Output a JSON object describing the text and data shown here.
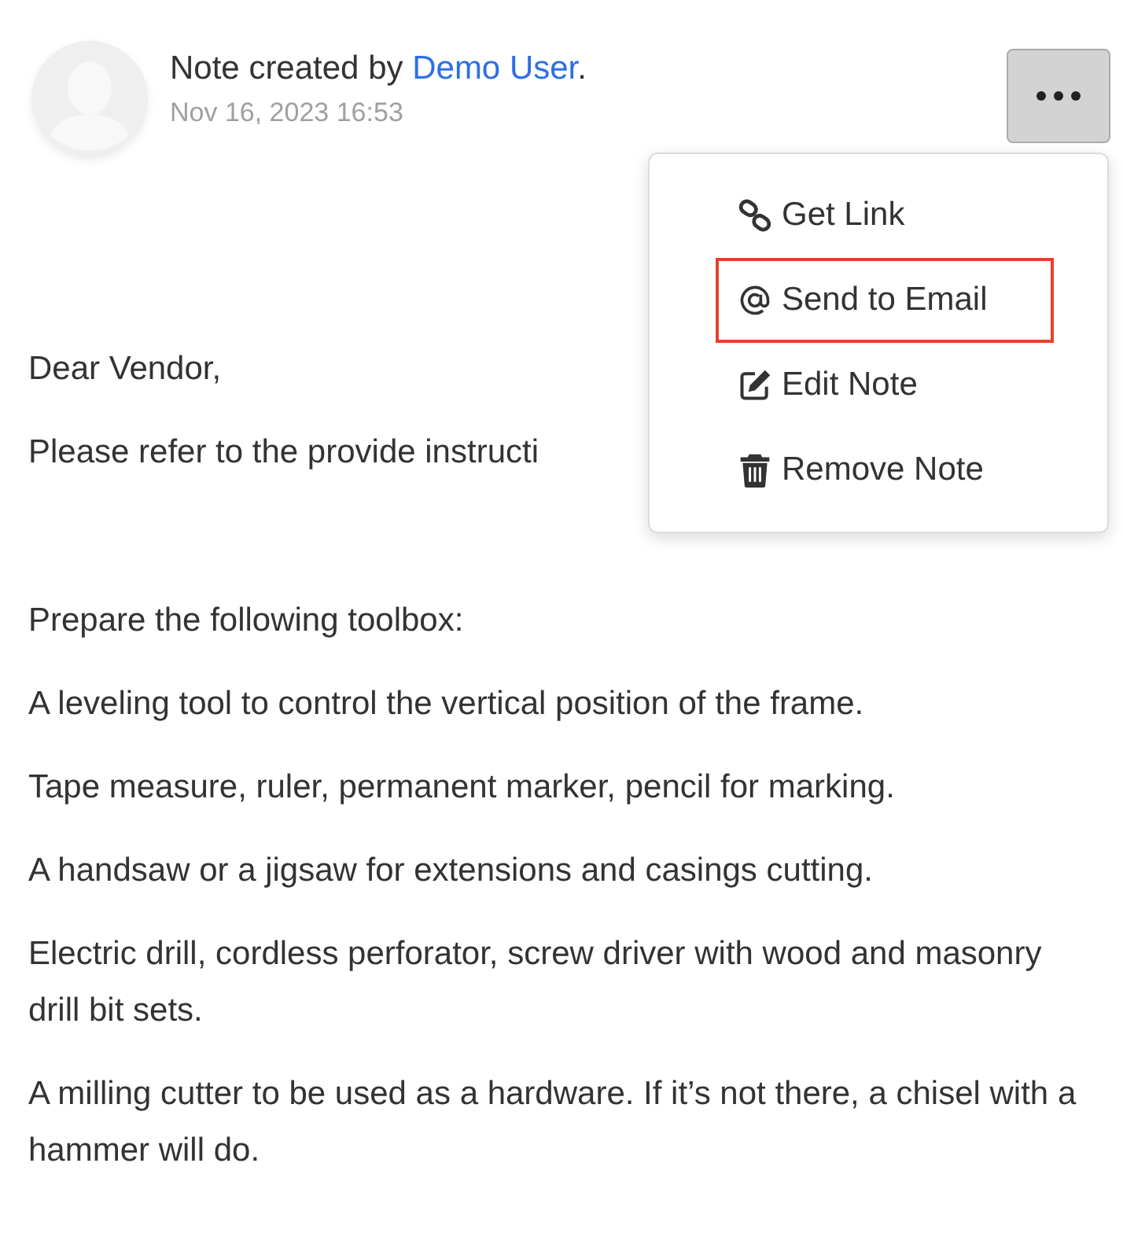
{
  "header": {
    "text_before": "Note created by ",
    "author": "Demo User",
    "text_after": ".",
    "date": "Nov 16, 2023 16:53"
  },
  "menu": {
    "open": true,
    "items": [
      {
        "kind": "link",
        "label": "Get Link",
        "highlighted": false
      },
      {
        "kind": "email",
        "label": "Send to Email",
        "highlighted": true
      },
      {
        "kind": "edit",
        "label": "Edit Note",
        "highlighted": false
      },
      {
        "kind": "trash",
        "label": "Remove Note",
        "highlighted": false
      }
    ]
  },
  "body": {
    "greeting": "Dear Vendor,",
    "intro": "Please refer to the provide instructi",
    "paragraphs": [
      "Prepare the following toolbox:",
      "A leveling tool to control the vertical position of the frame.",
      "Tape measure, ruler, permanent marker, pencil for marking.",
      "A handsaw or a jigsaw for extensions and casings cutting.",
      "Electric drill, cordless perforator, screw driver with wood and masonry drill bit sets.",
      "A milling cutter to be used as a hardware. If it’s not there, a chisel with a hammer will do."
    ]
  }
}
